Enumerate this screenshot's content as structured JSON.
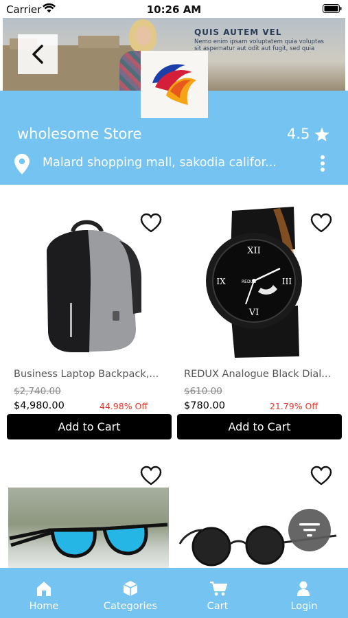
{
  "status_bar": {
    "carrier": "Carrier",
    "time": "10:26 AM"
  },
  "banner": {
    "title": "QUIS AUTEM VEL",
    "text": "Nemo enim ipsam voluptatem quia voluptas sit aspernatur aut odit aut fugit, sed quia"
  },
  "store": {
    "name": "wholesome Store",
    "rating": "4.5",
    "address": "Malard shopping mall, sakodia califor..."
  },
  "products": [
    {
      "name": "Business Laptop Backpack,...",
      "old_price": "$2,740.00",
      "price": "$4,980.00",
      "discount": "44.98% Off",
      "cart_label": "Add to Cart"
    },
    {
      "name": "REDUX Analogue Black Dial...",
      "old_price": "$610.00",
      "price": "$780.00",
      "discount": "21.79% Off",
      "cart_label": "Add to Cart"
    }
  ],
  "watch_brand": "REDUX",
  "bottom_nav": [
    {
      "label": "Home",
      "icon": "home-icon"
    },
    {
      "label": "Categories",
      "icon": "categories-icon"
    },
    {
      "label": "Cart",
      "icon": "cart-icon"
    },
    {
      "label": "Login",
      "icon": "user-icon"
    }
  ],
  "colors": {
    "accent": "#74c3f0",
    "discount": "#e8382c",
    "button": "#000000"
  }
}
